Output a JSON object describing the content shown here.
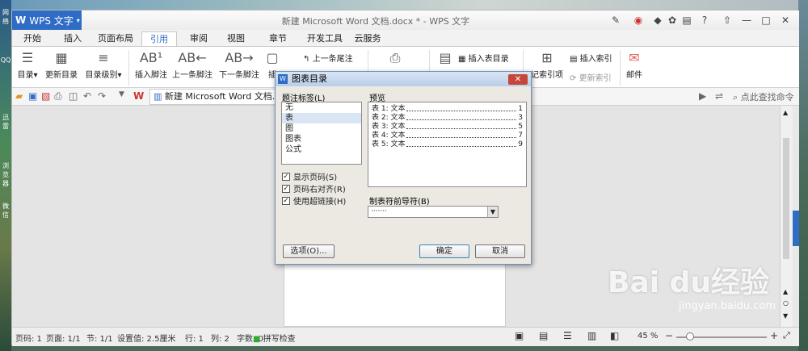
{
  "desktop": {
    "left_icons": [
      "网络",
      "QQ",
      "迅雷",
      "浏览器",
      "微信"
    ]
  },
  "window": {
    "app_name": "WPS 文字",
    "title": "新建 Microsoft Word 文档.docx * - WPS 文字",
    "controls": {
      "help": "?",
      "minimize": "—",
      "restore": "□",
      "close": "✕"
    }
  },
  "menu_tabs": [
    "开始",
    "插入",
    "页面布局",
    "引用",
    "审阅",
    "视图",
    "章节",
    "开发工具",
    "云服务"
  ],
  "active_tab": "引用",
  "ribbon": {
    "toc": "目录",
    "update_toc": "更新目录",
    "toc_level": "目录级别",
    "insert_footnote": "插入脚注",
    "prev_footnote": "上一条脚注",
    "next_footnote": "下一条脚注",
    "insert_caption": "插",
    "prev_endnote": "上一条尾注",
    "insert_table_toc": "插入表目录",
    "mark_index": "记索引项",
    "insert_index": "插入索引",
    "update_index": "更新索引",
    "mail": "邮件"
  },
  "doc_tab": "新建 Microsoft Word 文档.docx",
  "search_command": "点此查找命令",
  "status": {
    "page_no": "页码: 1",
    "pages": "页面: 1/1",
    "section": "节: 1/1",
    "setting": "设置值: 2.5厘米",
    "row": "行: 1",
    "col": "列: 2",
    "words": "字数: 0",
    "spell": "拼写检查",
    "zoom": "45 %"
  },
  "dialog": {
    "title": "图表目录",
    "caption_label": "题注标签(L)",
    "caption_items": [
      "无",
      "表",
      "图",
      "图表",
      "公式"
    ],
    "caption_selected": 1,
    "preview_label": "预览",
    "preview_lines": [
      {
        "label": "表 1: 文本",
        "page": "1"
      },
      {
        "label": "表 2: 文本",
        "page": "3"
      },
      {
        "label": "表 3: 文本",
        "page": "5"
      },
      {
        "label": "表 4: 文本",
        "page": "7"
      },
      {
        "label": "表 5: 文本",
        "page": "9"
      }
    ],
    "show_page_numbers": "显示页码(S)",
    "right_align": "页码右对齐(R)",
    "use_hyperlinks": "使用超链接(H)",
    "leader_label": "制表符前导符(B)",
    "leader_value": "·······",
    "options_btn": "选项(O)...",
    "ok_btn": "确定",
    "cancel_btn": "取消"
  },
  "watermark": {
    "brand": "Bai du经验",
    "url": "jingyan.baidu.com"
  }
}
